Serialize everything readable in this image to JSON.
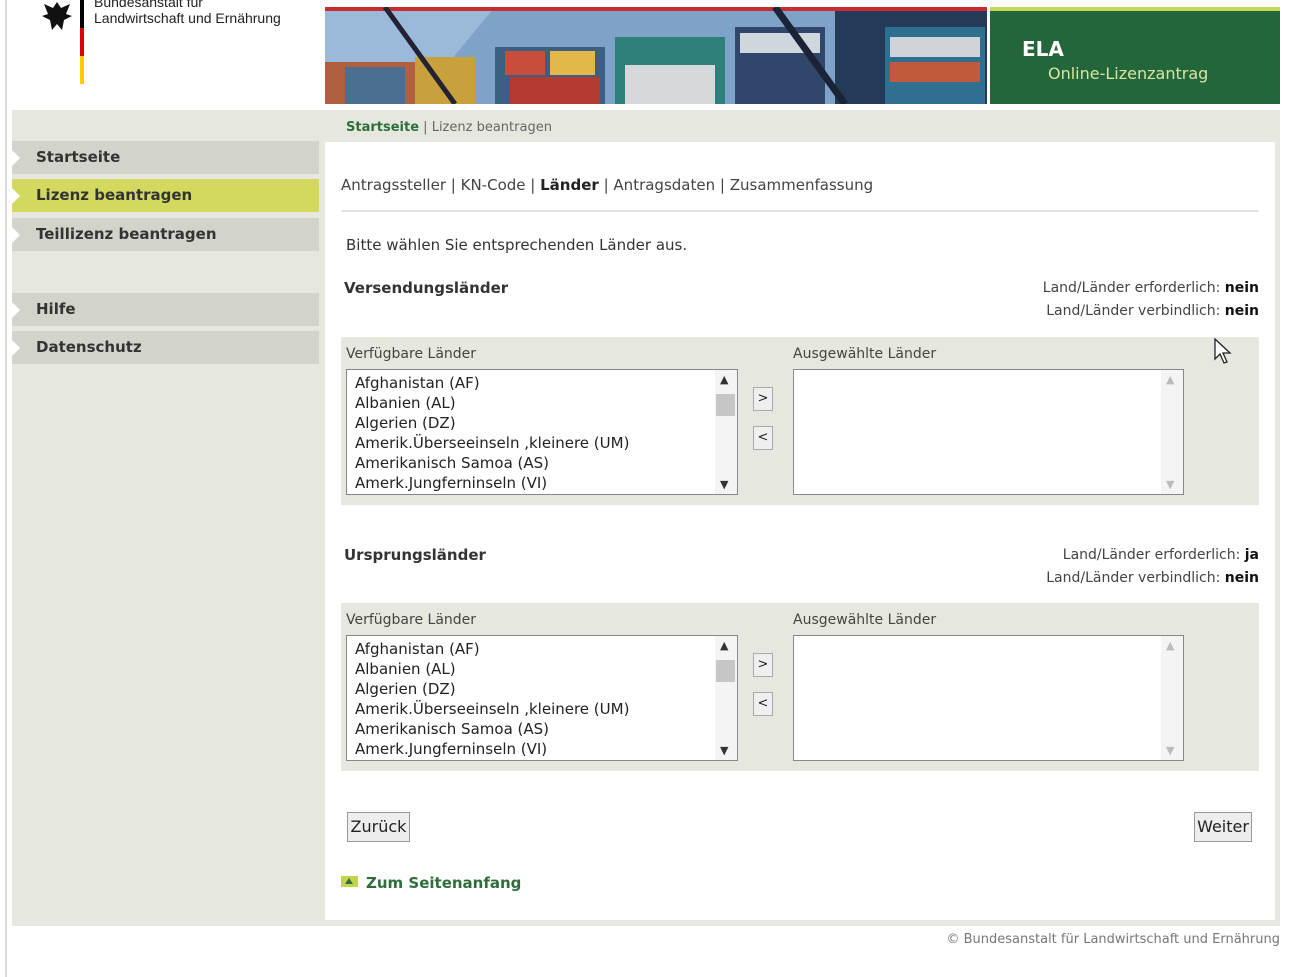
{
  "header": {
    "agency_line1": "Bundesanstalt für",
    "agency_line2": "Landwirtschaft und Ernährung",
    "app_title": "ELA",
    "app_subtitle": "Online-Lizenzantrag"
  },
  "breadcrumb": {
    "home": "Startseite",
    "separator": "|",
    "current": "Lizenz beantragen"
  },
  "sidebar": {
    "items": [
      {
        "label": "Startseite",
        "active": false
      },
      {
        "label": "Lizenz beantragen",
        "active": true
      },
      {
        "label": "Teillizenz beantragen",
        "active": false
      },
      {
        "label": "Hilfe",
        "active": false
      },
      {
        "label": "Datenschutz",
        "active": false
      }
    ]
  },
  "steps": {
    "items": [
      "Antragssteller",
      "KN-Code",
      "Länder",
      "Antragsdaten",
      "Zusammenfassung"
    ],
    "separator": "|",
    "current_index": 2
  },
  "intro": "Bitte wählen Sie entsprechenden Länder aus.",
  "sections": [
    {
      "title": "Versendungsländer",
      "required_label": "Land/Länder erforderlich:",
      "required_value": "nein",
      "binding_label": "Land/Länder verbindlich:",
      "binding_value": "nein",
      "available_label": "Verfügbare Länder",
      "selected_label": "Ausgewählte Länder",
      "available": [
        "Afghanistan (AF)",
        "Albanien (AL)",
        "Algerien (DZ)",
        "Amerik.Überseeinseln ,kleinere (UM)",
        "Amerikanisch Samoa (AS)",
        "Amerk.Jungferninseln (VI)"
      ],
      "add_label": ">",
      "remove_label": "<"
    },
    {
      "title": "Ursprungsländer",
      "required_label": "Land/Länder erforderlich:",
      "required_value": "ja",
      "binding_label": "Land/Länder verbindlich:",
      "binding_value": "nein",
      "available_label": "Verfügbare Länder",
      "selected_label": "Ausgewählte Länder",
      "available": [
        "Afghanistan (AF)",
        "Albanien (AL)",
        "Algerien (DZ)",
        "Amerik.Überseeinseln ,kleinere (UM)",
        "Amerikanisch Samoa (AS)",
        "Amerk.Jungferninseln (VI)"
      ],
      "add_label": ">",
      "remove_label": "<"
    }
  ],
  "buttons": {
    "back": "Zurück",
    "next": "Weiter"
  },
  "top_link": "Zum Seitenanfang",
  "footer": "© Bundesanstalt für Landwirtschaft und Ernährung",
  "icons": {
    "logo": "federal-eagle-icon",
    "nav_marker": "triangle-right-icon",
    "top_link": "arrow-up-icon",
    "cursor": "mouse-pointer-icon"
  },
  "colors": {
    "brand_green": "#24663c",
    "accent_yellow": "#d3d85f",
    "link_green": "#2f6e3b",
    "frame_grey": "#e6e8e0"
  }
}
